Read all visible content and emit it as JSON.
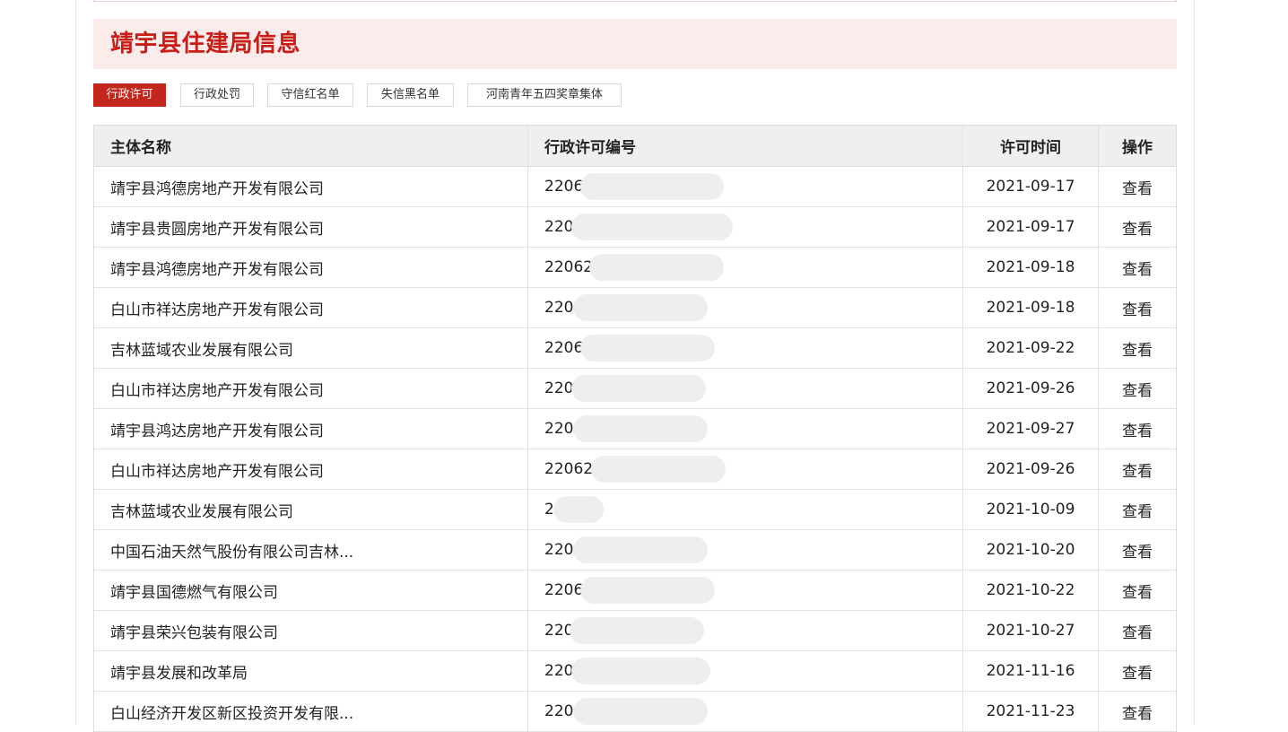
{
  "section": {
    "title": "靖宇县住建局信息"
  },
  "tabs": [
    {
      "label": "行政许可",
      "active": true
    },
    {
      "label": "行政处罚",
      "active": false
    },
    {
      "label": "守信红名单",
      "active": false
    },
    {
      "label": "失信黑名单",
      "active": false
    },
    {
      "label": "河南青年五四奖章集体",
      "active": false
    }
  ],
  "table": {
    "headers": {
      "name": "主体名称",
      "code": "行政许可编号",
      "date": "许可时间",
      "op": "操作"
    },
    "rows": [
      {
        "name": "靖宇县鸿德房地产开发有限公司",
        "code": "22062",
        "date": "2021-09-17",
        "op": "查看"
      },
      {
        "name": "靖宇县贵圆房地产开发有限公司",
        "code": "2206",
        "date": "2021-09-17",
        "op": "查看"
      },
      {
        "name": "靖宇县鸿德房地产开发有限公司",
        "code": "220622",
        "date": "2021-09-18",
        "op": "查看"
      },
      {
        "name": "白山市祥达房地产开发有限公司",
        "code": "22062",
        "date": "2021-09-18",
        "op": "查看"
      },
      {
        "name": "吉林蓝域农业发展有限公司",
        "code": "22061",
        "date": "2021-09-22",
        "op": "查看"
      },
      {
        "name": "白山市祥达房地产开发有限公司",
        "code": "22062",
        "date": "2021-09-26",
        "op": "查看"
      },
      {
        "name": "靖宇县鸿达房地产开发有限公司",
        "code": "22062",
        "date": "2021-09-27",
        "op": "查看"
      },
      {
        "name": "白山市祥达房地产开发有限公司",
        "code": "22062",
        "date": "2021-09-26",
        "op": "查看"
      },
      {
        "name": "吉林蓝域农业发展有限公司",
        "code": "202",
        "date": "2021-10-09",
        "op": "查看"
      },
      {
        "name": "中国石油天然气股份有限公司吉林...",
        "code": "2206",
        "date": "2021-10-20",
        "op": "查看"
      },
      {
        "name": "靖宇县国德燃气有限公司",
        "code": "22062",
        "date": "2021-10-22",
        "op": "查看"
      },
      {
        "name": "靖宇县荣兴包装有限公司",
        "code": "22062",
        "date": "2021-10-27",
        "op": "查看"
      },
      {
        "name": "靖宇县发展和改革局",
        "code": "22061",
        "date": "2021-11-16",
        "op": "查看"
      },
      {
        "name": "白山经济开发区新区投资开发有限...",
        "code": "22062",
        "date": "2021-11-23",
        "op": "查看"
      }
    ]
  }
}
